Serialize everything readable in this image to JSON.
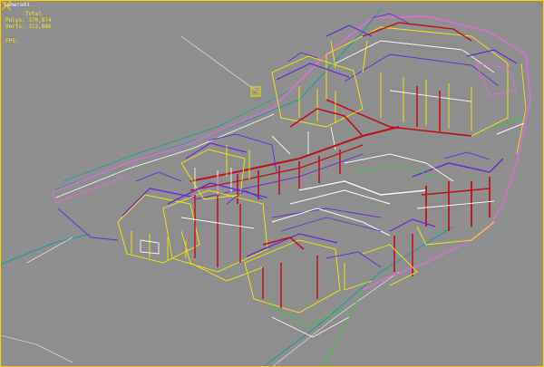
{
  "viewport": {
    "label": "Camera01",
    "stats": {
      "total_label": "Total",
      "polys_label": "Polys:",
      "polys_value": "370,874",
      "verts_label": "Verts:",
      "verts_value": "312,886"
    },
    "fps_label": "FPS:"
  },
  "colors": {
    "background": "#8e8e8e",
    "active_border": "#ffcc00",
    "stats_text": "#ffe600",
    "label_text": "#f2f2f2",
    "wire_red": "#c0141e",
    "wire_yellow": "#f2e600",
    "wire_purple": "#6a2bd8",
    "wire_white": "#f4f4f4",
    "wire_pink": "#e06ad8",
    "wire_green": "#2ec83a",
    "wire_cyan": "#1a9c9c"
  },
  "scene": {
    "object": "traditional-chinese-courtyard-complex-wireframe",
    "camera_target_icon": "camera-target-icon",
    "viewport_corner_icon": "viewport-maximize-icon"
  }
}
